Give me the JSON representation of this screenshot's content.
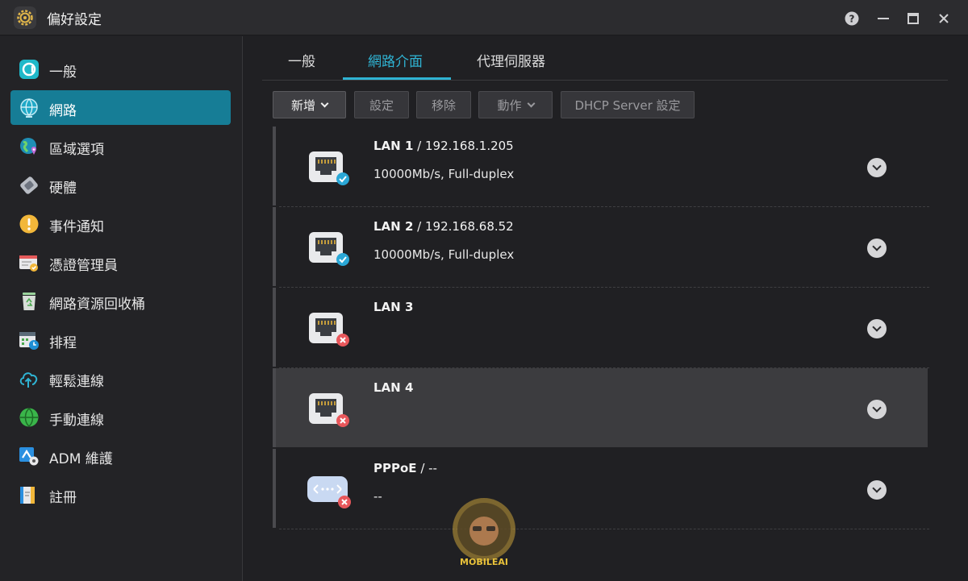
{
  "window": {
    "title": "偏好設定"
  },
  "sidebar": {
    "items": [
      {
        "label": "一般",
        "icon": "general-icon",
        "active": false
      },
      {
        "label": "網路",
        "icon": "globe-icon",
        "active": true
      },
      {
        "label": "區域選項",
        "icon": "region-icon",
        "active": false
      },
      {
        "label": "硬體",
        "icon": "hardware-icon",
        "active": false
      },
      {
        "label": "事件通知",
        "icon": "alert-icon",
        "active": false
      },
      {
        "label": "憑證管理員",
        "icon": "certificate-icon",
        "active": false
      },
      {
        "label": "網路資源回收桶",
        "icon": "recycle-bin-icon",
        "active": false
      },
      {
        "label": "排程",
        "icon": "schedule-icon",
        "active": false
      },
      {
        "label": "輕鬆連線",
        "icon": "cloud-connect-icon",
        "active": false
      },
      {
        "label": "手動連線",
        "icon": "manual-connect-icon",
        "active": false
      },
      {
        "label": "ADM 維護",
        "icon": "maintenance-icon",
        "active": false
      },
      {
        "label": "註冊",
        "icon": "register-icon",
        "active": false
      }
    ]
  },
  "tabs": [
    {
      "label": "一般",
      "active": false
    },
    {
      "label": "網路介面",
      "active": true
    },
    {
      "label": "代理伺服器",
      "active": false
    }
  ],
  "toolbar": {
    "add": "新增",
    "settings": "設定",
    "remove": "移除",
    "actions": "動作",
    "dhcp": "DHCP Server 設定"
  },
  "interfaces": [
    {
      "name": "LAN 1",
      "address": " / 192.168.1.205",
      "detail": "10000Mb/s, Full-duplex",
      "status": "connected",
      "icon": "ethernet-port-icon"
    },
    {
      "name": "LAN 2",
      "address": " / 192.168.68.52",
      "detail": "10000Mb/s, Full-duplex",
      "status": "connected",
      "icon": "ethernet-port-icon"
    },
    {
      "name": "LAN 3",
      "address": "",
      "detail": "",
      "status": "disconnected",
      "icon": "ethernet-port-icon"
    },
    {
      "name": "LAN 4",
      "address": "",
      "detail": "",
      "status": "disconnected",
      "icon": "ethernet-port-icon",
      "selected": true
    },
    {
      "name": "PPPoE",
      "address": " / --",
      "detail": "--",
      "status": "disconnected",
      "icon": "pppoe-icon"
    }
  ],
  "watermark": {
    "text": "MOBILEAI"
  },
  "colors": {
    "accent": "#2fb3d3",
    "active_item": "#167d96",
    "connected": "#2aa7d6",
    "disconnected": "#e8575b"
  }
}
